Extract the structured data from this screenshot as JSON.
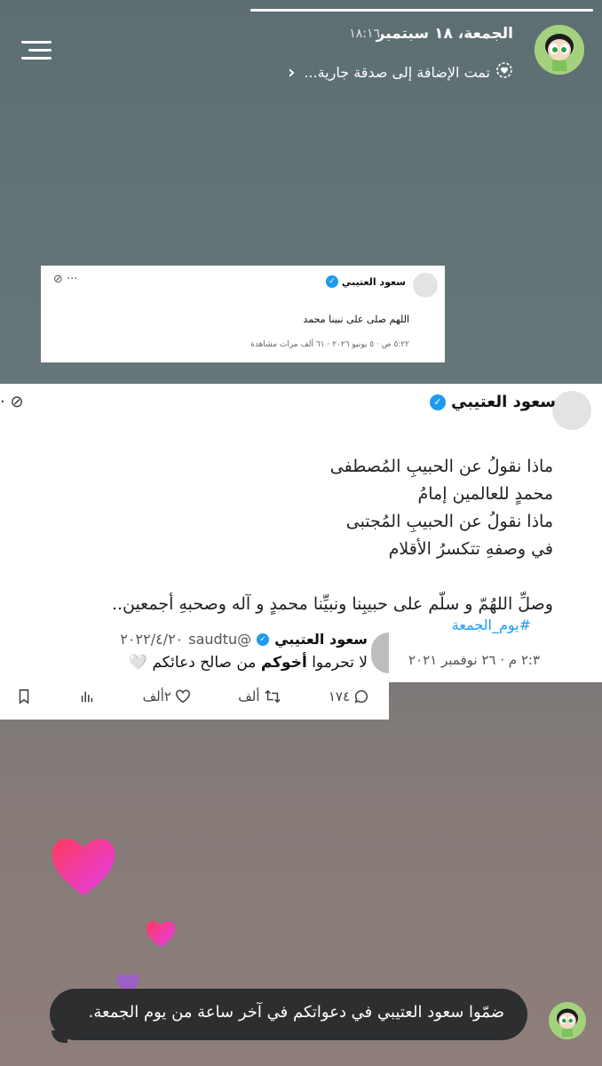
{
  "story": {
    "progress": 1.0,
    "date": "الجمعة، ١٨ سبتمبر",
    "time": "١٨:١٦",
    "subtitle": "تمت الإضافة إلى صدقة جارية...",
    "icons": {
      "menu": "menu-icon",
      "heart_badge": "heart-badge-icon",
      "chevron": "chevron-icon"
    }
  },
  "small_tweet": {
    "name": "سعود العتيبي",
    "text": "اللهم صلى على نبينا محمد",
    "meta": "٥:٢٢ ص · ٥ يونيو ٢٠٢٦ · ٦١ ألف مرات مشاهدة"
  },
  "main_tweet": {
    "name": "سعود العتيبي",
    "poem": [
      "ماذا نقولُ عن الحبيبِ المُصطفى",
      "محمدٍ للعالمين إمامُ",
      "ماذا نقولُ عن الحبيبِ المُجتبى",
      "في وصفهِ تتكسرُ الأقلام"
    ],
    "blessing": "وصلِّ اللهُمّ و سلّم على حبيبِنا ونبيِّنا محمدٍ و آله وصحبهِ أجمعين..",
    "hashtag": "#يوم_الجمعة",
    "meta": "٢:٣ م · ٢٦ نوفمبر ٢٠٢١"
  },
  "reply_tweet": {
    "name": "سعود العتيبي",
    "handle": "@saudtu",
    "date": "٢٠٢٢/٤/٢٠",
    "text_prefix": "لا تحرموا ",
    "text_bold": "أخوكم",
    "text_suffix": " من صالح دعائكم 🤍",
    "replies": "١٧٤",
    "retweets": "ألف",
    "likes": "٢ألف"
  },
  "caption": {
    "text": "ضمّوا سعود العتيبي في دعواتكم في آخر ساعة من يوم الجمعة."
  },
  "colors": {
    "verified": "#1d9bf0",
    "bubble": "#2c2e30",
    "heart_pink": "#ff2d78",
    "heart_purple": "#9d5bd2"
  }
}
